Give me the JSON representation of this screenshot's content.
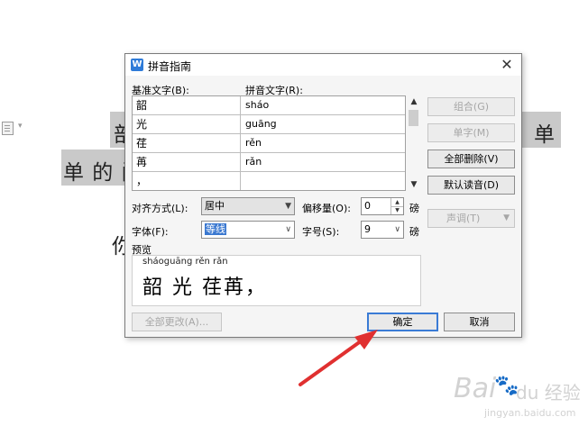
{
  "document": {
    "line1_left": "部",
    "line1_right": "单",
    "line2": "单 的 问",
    "line3": "你"
  },
  "dialog": {
    "title": "拼音指南",
    "app_icon": "W",
    "close_glyph": "✕",
    "col_base_label": "基准文字(B):",
    "col_pinyin_label": "拼音文字(R):",
    "rows": [
      {
        "base": "韶",
        "pinyin": "sháo"
      },
      {
        "base": "光",
        "pinyin": "guāng"
      },
      {
        "base": "荏",
        "pinyin": "rěn"
      },
      {
        "base": "苒",
        "pinyin": "rǎn"
      },
      {
        "base": "，",
        "pinyin": ""
      }
    ],
    "buttons": {
      "combine": "组合(G)",
      "single": "单字(M)",
      "clear_all": "全部删除(V)",
      "default_reading": "默认读音(D)",
      "tone": "声调(T)",
      "change_all": "全部更改(A)...",
      "ok": "确定",
      "cancel": "取消"
    },
    "align_label": "对齐方式(L):",
    "align_value": "居中",
    "offset_label": "偏移量(O):",
    "offset_value": "0",
    "font_label": "字体(F):",
    "font_value": "等线",
    "size_label": "字号(S):",
    "size_value": "9",
    "unit": "磅",
    "preview_label": "预览",
    "preview_pinyin": "sháoguāng rěn  rǎn",
    "preview_base": "韶 光 荏苒，"
  },
  "watermark": {
    "brand": "Bai",
    "paw": "🐾",
    "brand2": "du 经验",
    "url": "jingyan.baidu.com"
  },
  "colors": {
    "arrow": "#e03030",
    "ok_border": "#3a7bd5",
    "doc_highlight": "#c9c9c9"
  }
}
